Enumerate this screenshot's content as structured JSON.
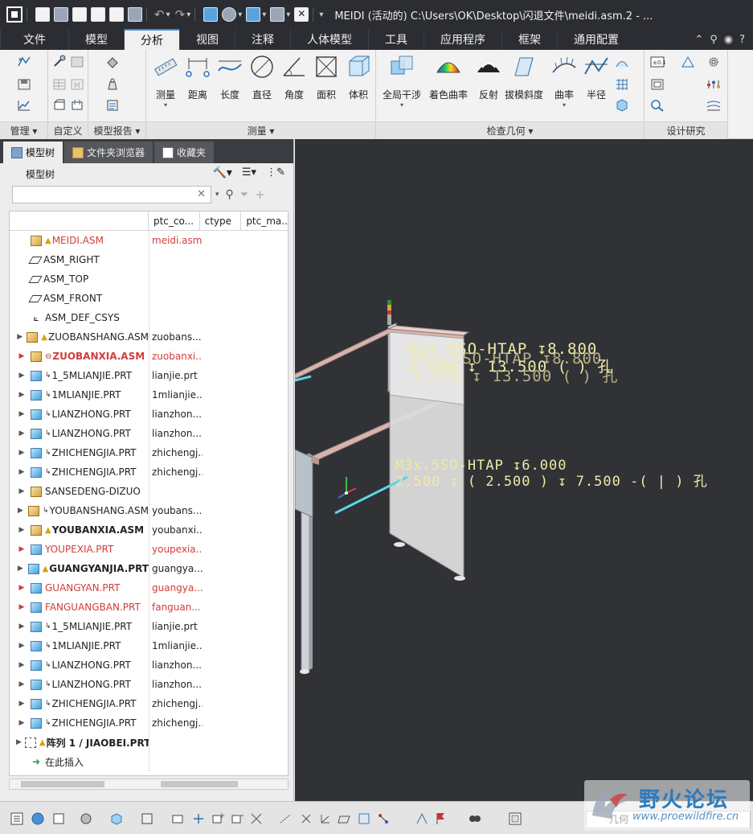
{
  "window": {
    "title": "MEIDI (活动的) C:\\Users\\OK\\Desktop\\闪退文件\\meidi.asm.2 - ..."
  },
  "menu_tabs": [
    "文件",
    "模型",
    "分析",
    "视图",
    "注释",
    "人体模型",
    "工具",
    "应用程序",
    "框架",
    "通用配置"
  ],
  "active_tab": "分析",
  "ribbon": {
    "groups": {
      "manage": "管理",
      "custom": "自定义",
      "model_report": "模型报告",
      "measure": "测量",
      "inspect_geometry": "检查几何",
      "design_study": "设计研究"
    },
    "measure_buttons": [
      "测量",
      "距离",
      "长度",
      "直径",
      "角度",
      "面积",
      "体积"
    ],
    "inspect_buttons": [
      "全局干涉",
      "着色曲率",
      "反射",
      "拔模斜度",
      "曲率",
      "半径"
    ]
  },
  "panel": {
    "tabs": [
      "模型树",
      "文件夹浏览器",
      "收藏夹"
    ],
    "header": "模型树",
    "columns": [
      "",
      "ptc_co...",
      "ctype",
      "ptc_ma..."
    ],
    "rows": [
      {
        "name": "MEIDI.ASM",
        "val": "meidi.asm",
        "icon": "asm",
        "flag": "warn",
        "red": true
      },
      {
        "name": "ASM_RIGHT",
        "val": "",
        "icon": "plane"
      },
      {
        "name": "ASM_TOP",
        "val": "",
        "icon": "plane"
      },
      {
        "name": "ASM_FRONT",
        "val": "",
        "icon": "plane"
      },
      {
        "name": "ASM_DEF_CSYS",
        "val": "",
        "icon": "csys"
      },
      {
        "name": "ZUOBANSHANG.ASM",
        "val": "zuobans...",
        "icon": "asm",
        "flag": "warn",
        "exp": true
      },
      {
        "name": "ZUOBANXIA.ASM",
        "val": "zuobanxi...",
        "icon": "asm",
        "flag": "err",
        "exp": true,
        "red": true,
        "bold": true
      },
      {
        "name": "1_5MLIANJIE.PRT",
        "val": "lianjie.prt",
        "icon": "prt",
        "flag": "sub",
        "exp": true
      },
      {
        "name": "1MLIANJIE.PRT",
        "val": "1mlianjie....",
        "icon": "prt",
        "flag": "sub",
        "exp": true
      },
      {
        "name": "LIANZHONG.PRT",
        "val": "lianzhon...",
        "icon": "prt",
        "flag": "sub",
        "exp": true
      },
      {
        "name": "LIANZHONG.PRT",
        "val": "lianzhon...",
        "icon": "prt",
        "flag": "sub",
        "exp": true
      },
      {
        "name": "ZHICHENGJIA.PRT",
        "val": "zhichengj...",
        "icon": "prt",
        "flag": "sub",
        "exp": true
      },
      {
        "name": "ZHICHENGJIA.PRT",
        "val": "zhichengj...",
        "icon": "prt",
        "flag": "sub",
        "exp": true
      },
      {
        "name": "SANSEDENG-DIZUO",
        "val": "",
        "icon": "asm",
        "exp": true
      },
      {
        "name": "YOUBANSHANG.ASM",
        "val": "youbans...",
        "icon": "asm",
        "flag": "sub",
        "exp": true
      },
      {
        "name": "YOUBANXIA.ASM",
        "val": "youbanxi...",
        "icon": "asm",
        "flag": "warn",
        "exp": true,
        "bold": true
      },
      {
        "name": "YOUPEXIA.PRT",
        "val": "youpexia...",
        "icon": "prt",
        "exp": true,
        "red": true
      },
      {
        "name": "GUANGYANJIA.PRT",
        "val": "guangya...",
        "icon": "prt",
        "flag": "warn",
        "exp": true,
        "bold": true
      },
      {
        "name": "GUANGYAN.PRT",
        "val": "guangya...",
        "icon": "prt",
        "exp": true,
        "red": true
      },
      {
        "name": "FANGUANGBAN.PRT",
        "val": "fanguan...",
        "icon": "prt",
        "exp": true,
        "red": true
      },
      {
        "name": "1_5MLIANJIE.PRT",
        "val": "lianjie.prt",
        "icon": "prt",
        "flag": "sub",
        "exp": true
      },
      {
        "name": "1MLIANJIE.PRT",
        "val": "1mlianjie....",
        "icon": "prt",
        "flag": "sub",
        "exp": true
      },
      {
        "name": "LIANZHONG.PRT",
        "val": "lianzhon...",
        "icon": "prt",
        "flag": "sub",
        "exp": true
      },
      {
        "name": "LIANZHONG.PRT",
        "val": "lianzhon...",
        "icon": "prt",
        "flag": "sub",
        "exp": true
      },
      {
        "name": "ZHICHENGJIA.PRT",
        "val": "zhichengj...",
        "icon": "prt",
        "flag": "sub",
        "exp": true
      },
      {
        "name": "ZHICHENGJIA.PRT",
        "val": "zhichengj...",
        "icon": "prt",
        "flag": "sub",
        "exp": true
      },
      {
        "name": "阵列 1 / JIAOBEI.PRT",
        "val": "",
        "icon": "pattern",
        "flag": "warn",
        "exp": true,
        "bold": true
      },
      {
        "name": "在此插入",
        "val": "",
        "icon": "insert"
      }
    ]
  },
  "viewport": {
    "annotation_upper": [
      "M5x.8SO-HTAP ↧8.800",
      "4.500 ↧ 13.500 ( ) 孔"
    ],
    "annotation_lower": [
      "M3x.5SO-HTAP ↧6.000",
      "2.500 ↧ ( 2.500 ) ↧ 7.500 -( | ) 孔"
    ]
  },
  "status": {
    "filter_value": "几何"
  },
  "watermark": {
    "title": "野火论坛",
    "url": "www.proewildfire.cn"
  },
  "colors": {
    "accent": "#3c8dde",
    "error_red": "#d23c3c",
    "annotation_yellow": "#efe9a6",
    "viewport_bg": "#303236"
  }
}
